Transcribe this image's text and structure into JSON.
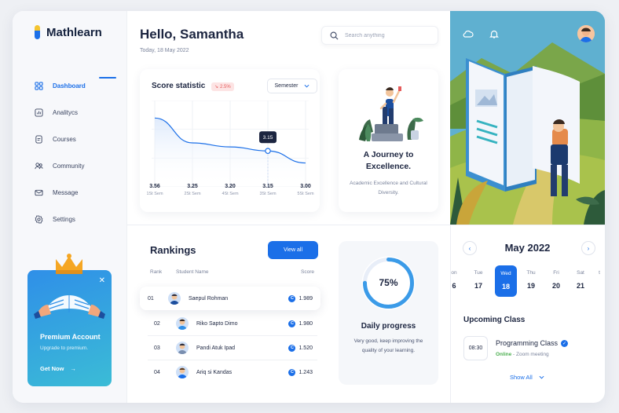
{
  "app": {
    "name": "Mathlearn"
  },
  "nav": {
    "items": [
      {
        "label": "Dashboard"
      },
      {
        "label": "Analitycs"
      },
      {
        "label": "Courses"
      },
      {
        "label": "Community"
      },
      {
        "label": "Message"
      },
      {
        "label": "Settings"
      }
    ]
  },
  "header": {
    "greeting": "Hello, Samantha",
    "date": "Today, 18 May 2022",
    "search_placeholder": "Search anything"
  },
  "score": {
    "title": "Score statistic",
    "badge": "2.5%",
    "filter": "Semester",
    "tooltip": "3.15"
  },
  "chart_data": {
    "type": "area",
    "title": "Score statistic",
    "categories": [
      "1St Sem",
      "2St Sem",
      "4St Sem",
      "3St Sem",
      "5St Sem"
    ],
    "values": [
      3.56,
      3.25,
      3.2,
      3.15,
      3.0
    ],
    "value_labels": [
      "3.56",
      "3.25",
      "3.20",
      "3.15",
      "3.00"
    ],
    "highlight_index": 3,
    "colors": {
      "line": "#1b6fe8",
      "fill": "#dbe8fb"
    }
  },
  "journey": {
    "title": "A Journey to Excellence.",
    "subtitle": "Academic Excellence and Cultural Diversity."
  },
  "rankings": {
    "title": "Rankings",
    "view_all": "View all",
    "headers": {
      "rank": "Rank",
      "name": "Student Name",
      "score": "Score"
    },
    "rows": [
      {
        "rank": "01",
        "name": "Saepul Rohman",
        "score": "1.989"
      },
      {
        "rank": "02",
        "name": "Riko Sapto Dimo",
        "score": "1.980"
      },
      {
        "rank": "03",
        "name": "Pandi Atuk Ipad",
        "score": "1.520"
      },
      {
        "rank": "04",
        "name": "Ariq si Kandas",
        "score": "1.243"
      }
    ],
    "coin_glyph": "C"
  },
  "daily": {
    "percent_label": "75%",
    "progress": 0.75,
    "title": "Daily progress",
    "subtitle": "Very good, keep improving the quality of your learning."
  },
  "premium": {
    "title": "Premium Account",
    "subtitle": "Upgrade to premium.",
    "cta": "Get Now"
  },
  "calendar": {
    "month": "May 2022",
    "days": [
      {
        "name": "on",
        "date": "6"
      },
      {
        "name": "Tue",
        "date": "17"
      },
      {
        "name": "Wed",
        "date": "18"
      },
      {
        "name": "Thu",
        "date": "19"
      },
      {
        "name": "Fri",
        "date": "20"
      },
      {
        "name": "Sat",
        "date": "21"
      },
      {
        "name": "t",
        "date": ""
      }
    ]
  },
  "upcoming": {
    "title": "Upcoming Class",
    "time": "08:30",
    "name": "Programming Class",
    "status": "Online",
    "detail": " - Zoom meeting",
    "show_all": "Show All"
  },
  "colors": {
    "accent": "#1b6fe8",
    "danger": "#e55b5b",
    "success": "#4caf50"
  }
}
